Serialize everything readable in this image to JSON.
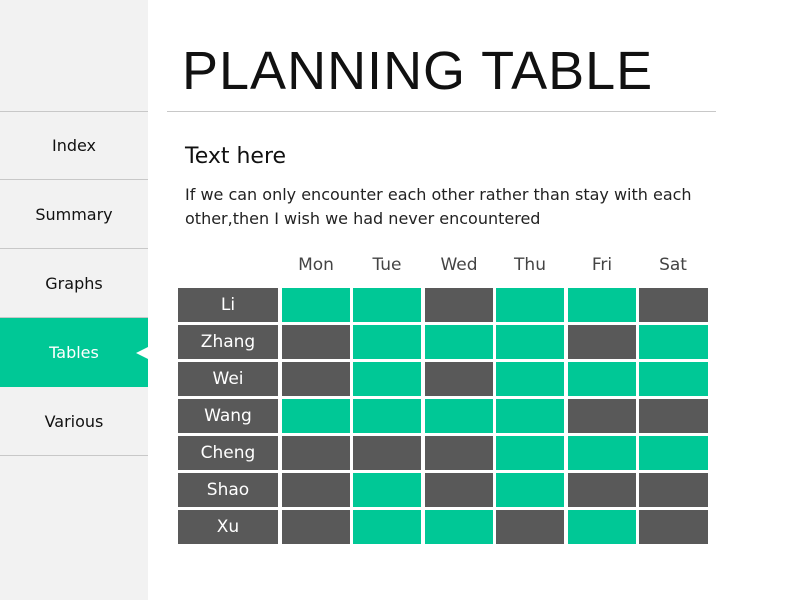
{
  "colors": {
    "accent": "#00c896",
    "busy": "#595959"
  },
  "sidebar": {
    "items": [
      {
        "label": "Index",
        "active": false
      },
      {
        "label": "Summary",
        "active": false
      },
      {
        "label": "Graphs",
        "active": false
      },
      {
        "label": "Tables",
        "active": true
      },
      {
        "label": "Various",
        "active": false
      }
    ]
  },
  "header": {
    "title": "PLANNING TABLE"
  },
  "content": {
    "subtitle": "Text here",
    "paragraph": "If we can only encounter each other rather than stay with each other,then I wish we had never encountered"
  },
  "table": {
    "days": [
      "Mon",
      "Tue",
      "Wed",
      "Thu",
      "Fri",
      "Sat"
    ],
    "rows": [
      {
        "name": "Li",
        "available": [
          true,
          true,
          false,
          true,
          true,
          false
        ]
      },
      {
        "name": "Zhang",
        "available": [
          false,
          true,
          true,
          true,
          false,
          true
        ]
      },
      {
        "name": "Wei",
        "available": [
          false,
          true,
          false,
          true,
          true,
          true
        ]
      },
      {
        "name": "Wang",
        "available": [
          true,
          true,
          true,
          true,
          false,
          false
        ]
      },
      {
        "name": "Cheng",
        "available": [
          false,
          false,
          false,
          true,
          true,
          true
        ]
      },
      {
        "name": "Shao",
        "available": [
          false,
          true,
          false,
          true,
          false,
          false
        ]
      },
      {
        "name": "Xu",
        "available": [
          false,
          true,
          true,
          false,
          true,
          false
        ]
      }
    ]
  }
}
